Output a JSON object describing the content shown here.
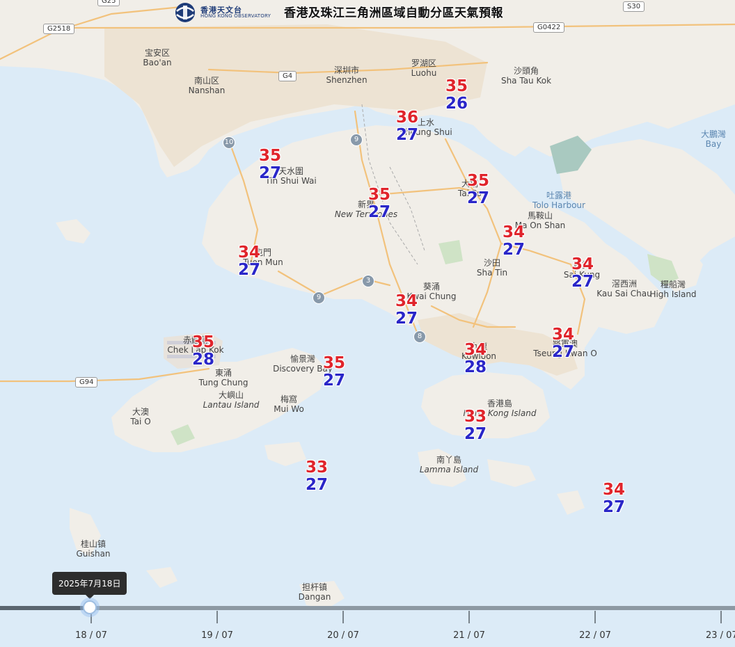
{
  "header": {
    "logo_zh": "香港天文台",
    "logo_en": "HONG KONG OBSERVATORY",
    "title": "香港及珠江三角洲區域自動分區天氣預報"
  },
  "timeline": {
    "selected_tooltip": "2025年7月18日",
    "dates": [
      "18 / 07",
      "19 / 07",
      "20 / 07",
      "21 / 07",
      "22 / 07",
      "23 / 07"
    ]
  },
  "map_labels": [
    {
      "zh": "宝安区",
      "en": "Bao'an"
    },
    {
      "zh": "南山区",
      "en": "Nanshan"
    },
    {
      "zh": "深圳市",
      "en": "Shenzhen"
    },
    {
      "zh": "罗湖区",
      "en": "Luohu"
    },
    {
      "zh": "沙頭角",
      "en": "Sha Tau Kok"
    },
    {
      "zh": "大鵬灣",
      "en": "Bay"
    },
    {
      "zh": "吐露港",
      "en": "Tolo Harbour"
    },
    {
      "zh": "馬鞍山",
      "en": "Ma On Shan"
    },
    {
      "zh": "新界",
      "en": "New Territories"
    },
    {
      "zh": "天水圍",
      "en": "Tin Shui Wai"
    },
    {
      "zh": "上水",
      "en": "Sheung Shui"
    },
    {
      "zh": "屯門",
      "en": "Tuen Mun"
    },
    {
      "zh": "沙田",
      "en": "Sha Tin"
    },
    {
      "zh": "葵涌",
      "en": "Kwai Chung"
    },
    {
      "zh": "滘西洲",
      "en": "Kau Sai Chau"
    },
    {
      "zh": "糧船灣",
      "en": "High Island"
    },
    {
      "zh": "愉景灣",
      "en": "Discovery Bay"
    },
    {
      "zh": "東涌",
      "en": "Tung Chung"
    },
    {
      "zh": "大嶼山",
      "en": "Lantau Island"
    },
    {
      "zh": "梅窩",
      "en": "Mui Wo"
    },
    {
      "zh": "大澳",
      "en": "Tai O"
    },
    {
      "zh": "香港島",
      "en": "Hong Kong Island"
    },
    {
      "zh": "南丫島",
      "en": "Lamma Island"
    },
    {
      "zh": "九龍",
      "en": "Kowloon"
    },
    {
      "zh": "將軍澳",
      "en": "Tseung Kwan O"
    },
    {
      "zh": "桂山镇",
      "en": "Guishan"
    },
    {
      "zh": "担杆镇",
      "en": "Dangan"
    },
    {
      "zh": "大埔",
      "en": "Tai Po"
    },
    {
      "zh": "西貢",
      "en": "Sai Kung"
    },
    {
      "zh": "赤鱲角",
      "en": "Chek Lap Kok"
    }
  ],
  "road_shields": [
    "G25",
    "G2518",
    "G4",
    "G0422",
    "S30",
    "G94",
    "10",
    "9",
    "9",
    "3",
    "8"
  ],
  "forecasts": [
    {
      "max": "35",
      "min": "26"
    },
    {
      "max": "36",
      "min": "27"
    },
    {
      "max": "35",
      "min": "27"
    },
    {
      "max": "35",
      "min": "27"
    },
    {
      "max": "35",
      "min": "27"
    },
    {
      "max": "34",
      "min": "27"
    },
    {
      "max": "34",
      "min": "27"
    },
    {
      "max": "34",
      "min": "27"
    },
    {
      "max": "34",
      "min": "27"
    },
    {
      "max": "35",
      "min": "28"
    },
    {
      "max": "34",
      "min": "28"
    },
    {
      "max": "34",
      "min": "27"
    },
    {
      "max": "35",
      "min": "27"
    },
    {
      "max": "33",
      "min": "27"
    },
    {
      "max": "33",
      "min": "27"
    },
    {
      "max": "34",
      "min": "27"
    }
  ]
}
